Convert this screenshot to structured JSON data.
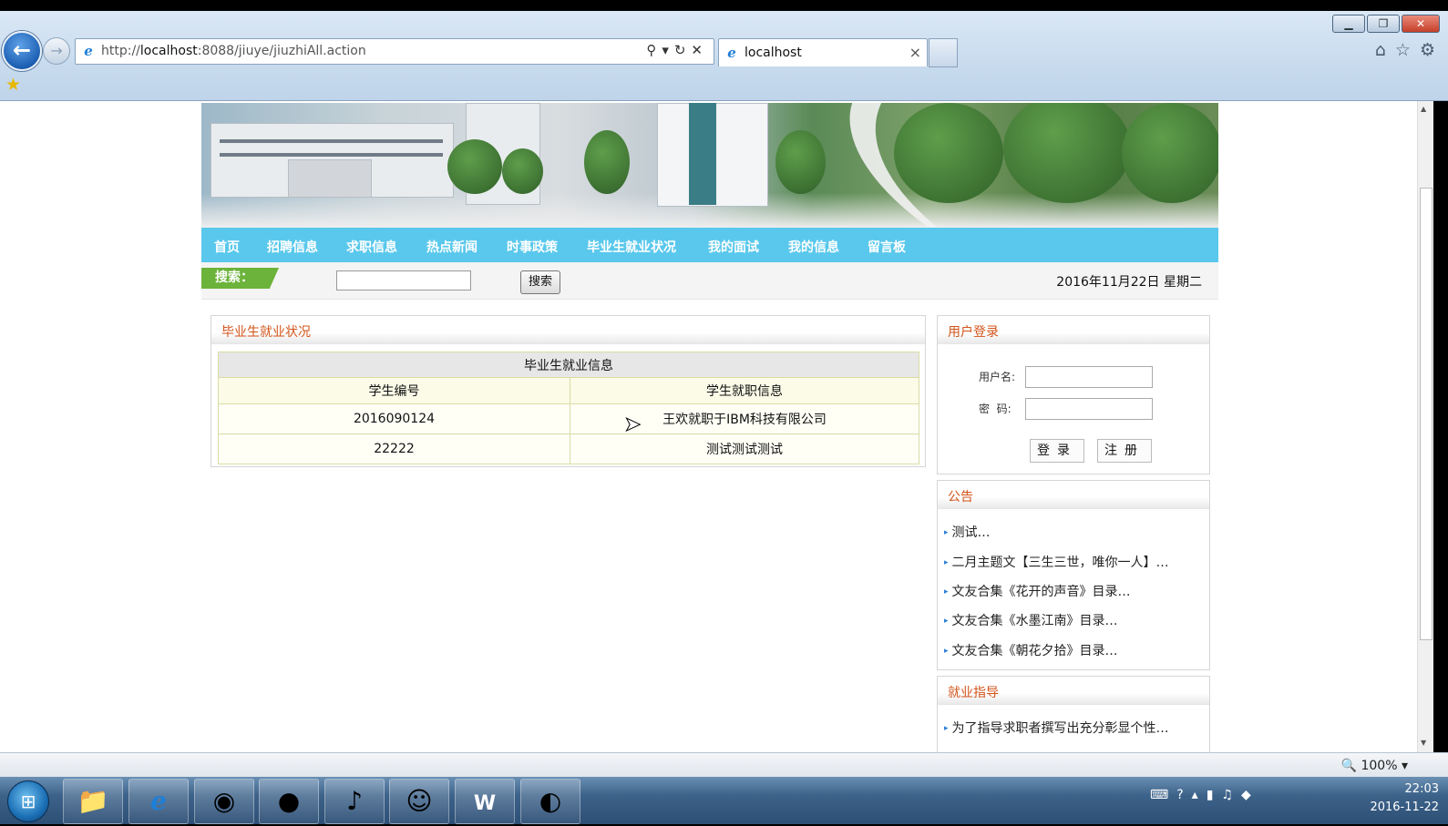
{
  "browser": {
    "address_prefix": "http://",
    "address_host": "localhost",
    "address_rest": ":8088/jiuye/jiuzhiAll.action",
    "tab_title": "localhost",
    "zoom": "100%"
  },
  "nav": {
    "items": [
      "首页",
      "招聘信息",
      "求职信息",
      "热点新闻",
      "时事政策",
      "毕业生就业状况",
      "我的面试",
      "我的信息",
      "留言板"
    ]
  },
  "search": {
    "label": "搜索：",
    "button": "搜索",
    "date": "2016年11月22日 星期二"
  },
  "main": {
    "title": "毕业生就业状况",
    "table_caption": "毕业生就业信息",
    "headers": [
      "学生编号",
      "学生就职信息"
    ],
    "rows": [
      {
        "id": "2016090124",
        "info": "王欢就职于IBM科技有限公司"
      },
      {
        "id": "22222",
        "info": "测试测试测试"
      }
    ]
  },
  "login": {
    "title": "用户登录",
    "username_label": "用户名:",
    "password_label": "密  码:",
    "login_button": "登录",
    "register_button": "注册"
  },
  "notices": {
    "title": "公告",
    "items": [
      "测试…",
      "二月主题文【三生三世，唯你一人】…",
      "文友合集《花开的声音》目录…",
      "文友合集《水墨江南》目录…",
      "文友合集《朝花夕拾》目录…"
    ]
  },
  "guidance": {
    "title": "就业指导",
    "items": [
      "为了指导求职者撰写出充分彰显个性…"
    ]
  },
  "taskbar": {
    "time": "22:03",
    "date": "2016-11-22"
  }
}
